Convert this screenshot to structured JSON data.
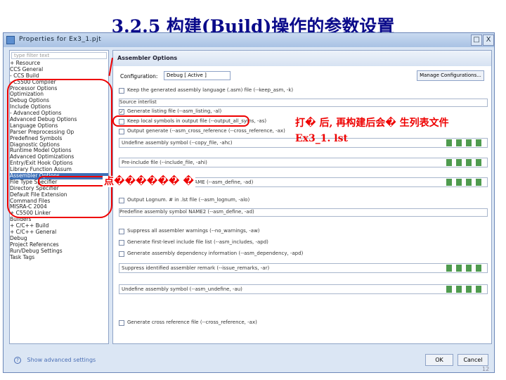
{
  "slide": {
    "title": "3.2.5 构建(Build)操作的参数设置"
  },
  "window": {
    "title": "Properties for Ex3_1.pjt",
    "min_label": "□",
    "close_label": "X"
  },
  "left_pane": {
    "filter_placeholder": "type filter text",
    "items": [
      {
        "label": "+ Resource"
      },
      {
        "label": "  CCS General"
      },
      {
        "label": "- CCS Build"
      },
      {
        "label": "   - C5500 Compiler"
      },
      {
        "label": "       Processor Options"
      },
      {
        "label": "       Optimization"
      },
      {
        "label": "       Debug Options"
      },
      {
        "label": "       Include Options"
      },
      {
        "label": "     - Advanced Options"
      },
      {
        "label": "        Advanced Debug Options"
      },
      {
        "label": "        Language Options"
      },
      {
        "label": "        Parser Preprocessing Op"
      },
      {
        "label": "        Predefined Symbols"
      },
      {
        "label": "        Diagnostic Options"
      },
      {
        "label": "        Runtime Model Options"
      },
      {
        "label": "        Advanced Optimizations"
      },
      {
        "label": "        Entry/Exit Hook Options"
      },
      {
        "label": "        Library Function Assum"
      },
      {
        "label": "        Assembler Options"
      },
      {
        "label": "        File Type Specifier"
      },
      {
        "label": "        Directory Specifier"
      },
      {
        "label": "        Default File Extension"
      },
      {
        "label": "        Command Files"
      },
      {
        "label": "        MISRA-C 2004"
      },
      {
        "label": "   + C5500 Linker"
      },
      {
        "label": "  Builders"
      },
      {
        "label": "+ C/C++ Build"
      },
      {
        "label": "+ C/C++ General"
      },
      {
        "label": "  Debug"
      },
      {
        "label": "  Project References"
      },
      {
        "label": "  Run/Debug Settings"
      },
      {
        "label": "  Task Tags"
      }
    ],
    "selected_index": 18
  },
  "right_pane": {
    "header": "Assembler Options",
    "config_label": "Configuration:",
    "config_value": "Debug [ Active ]",
    "manage_label": "Manage Configurations...",
    "options": [
      {
        "kind": "chk",
        "checked": false,
        "label": "Keep the generated assembly language (.asm) file (--keep_asm, -k)"
      },
      {
        "kind": "txt",
        "label": "Source interlist"
      },
      {
        "kind": "chk",
        "checked": true,
        "label": "Generate listing file (--asm_listing, -al)"
      },
      {
        "kind": "chk",
        "checked": false,
        "label": "Keep local symbols in output file (--output_all_syms, -as)"
      },
      {
        "kind": "chk",
        "checked": false,
        "label": "Output generate (--asm_cross_reference (--cross_reference, -ax)"
      },
      {
        "kind": "lst",
        "label": "Undefine assembly symbol (--copy_file, -ahc)"
      },
      {
        "kind": "lst",
        "label": "Pre-include file (--include_file, -ahi)"
      },
      {
        "kind": "lst",
        "label": "Predefine assembly symbol NAME (--asm_define, -ad)"
      },
      {
        "kind": "chk",
        "checked": false,
        "label": "Output Lognum. # in .lst file (--asm_lognum, -alo)"
      },
      {
        "kind": "txt",
        "label": "Predefine assembly symbol NAME2 (--asm_define, -ad)"
      },
      {
        "kind": "chk",
        "checked": false,
        "label": "Suppress all assembler warnings (--no_warnings, -aw)"
      },
      {
        "kind": "chk",
        "checked": false,
        "label": "Generate first-level include file list (--asm_includes, -apd)"
      },
      {
        "kind": "chk",
        "checked": false,
        "label": "Generate assembly dependency information (--asm_dependency, -apd)"
      },
      {
        "kind": "lst",
        "label": "Suppress identified assembler remark (--issue_remarks, -ar)"
      },
      {
        "kind": "lst",
        "label": "Undefine assembly symbol (--asm_undefine, -au)"
      },
      {
        "kind": "chk",
        "checked": false,
        "label": "Generate cross reference file (--cross_reference, -ax)"
      }
    ]
  },
  "footer": {
    "help_label": "?",
    "info_label": "Show advanced settings",
    "ok_label": "OK",
    "cancel_label": "Cancel"
  },
  "annotations": {
    "text1": "打� 后, 再构建后会� 生列表文件",
    "text2": "Ex3_1. lst",
    "text3": "点������ �"
  },
  "slide_number": "12"
}
